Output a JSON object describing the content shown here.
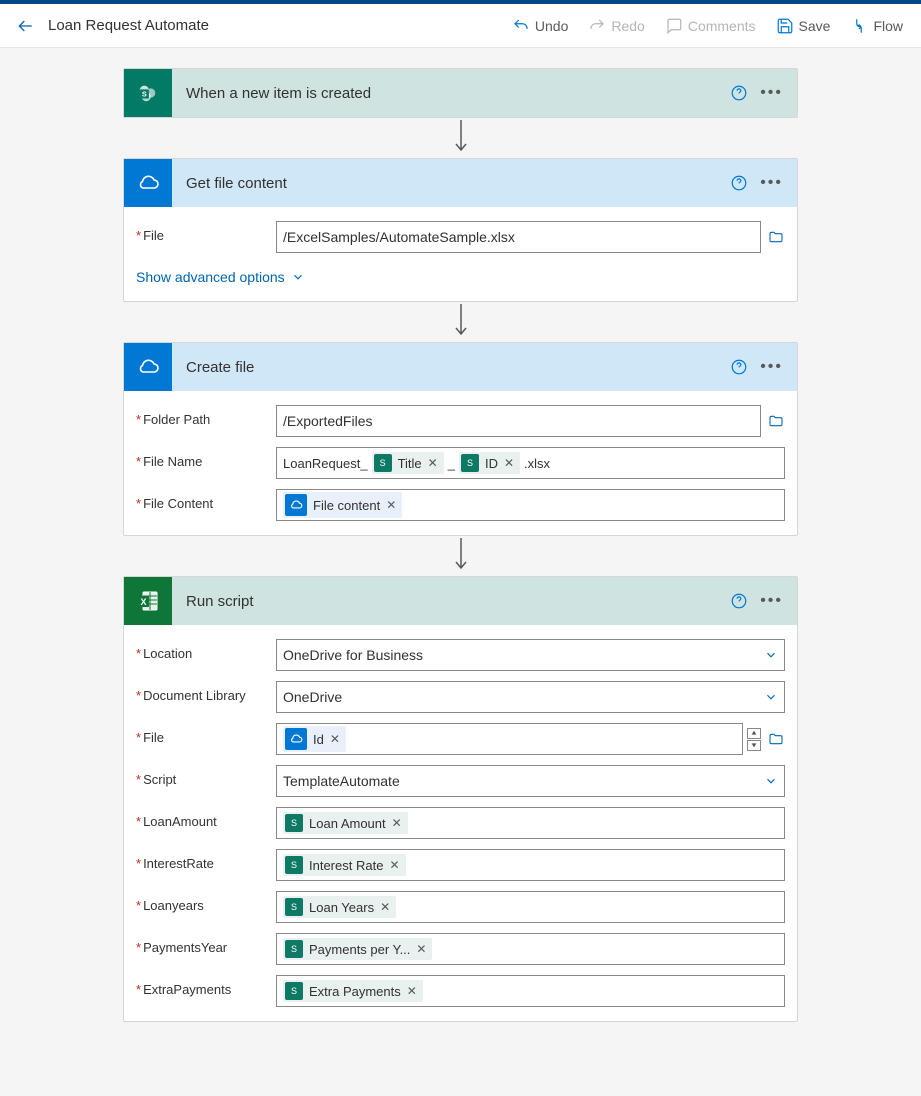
{
  "header": {
    "title": "Loan Request Automate",
    "undo": "Undo",
    "redo": "Redo",
    "comments": "Comments",
    "save": "Save",
    "flow": "Flow"
  },
  "steps": {
    "trigger": {
      "title": "When a new item is created"
    },
    "getfile": {
      "title": "Get file content",
      "file_label": "File",
      "file_value": "/ExcelSamples/AutomateSample.xlsx",
      "advanced": "Show advanced options"
    },
    "createfile": {
      "title": "Create file",
      "folder_label": "Folder Path",
      "folder_value": "/ExportedFiles",
      "name_label": "File Name",
      "name_prefix": "LoanRequest_",
      "name_sep": "_",
      "name_suffix": ".xlsx",
      "tok_title": "Title",
      "tok_id": "ID",
      "content_label": "File Content",
      "tok_filecontent": "File content"
    },
    "runscript": {
      "title": "Run script",
      "location_label": "Location",
      "location_value": "OneDrive for Business",
      "lib_label": "Document Library",
      "lib_value": "OneDrive",
      "file_label": "File",
      "tok_fileid": "Id",
      "script_label": "Script",
      "script_value": "TemplateAutomate",
      "la_label": "LoanAmount",
      "la_tok": "Loan Amount",
      "ir_label": "InterestRate",
      "ir_tok": "Interest Rate",
      "ly_label": "Loanyears",
      "ly_tok": "Loan Years",
      "py_label": "PaymentsYear",
      "py_tok": "Payments per Y...",
      "ep_label": "ExtraPayments",
      "ep_tok": "Extra Payments"
    }
  }
}
